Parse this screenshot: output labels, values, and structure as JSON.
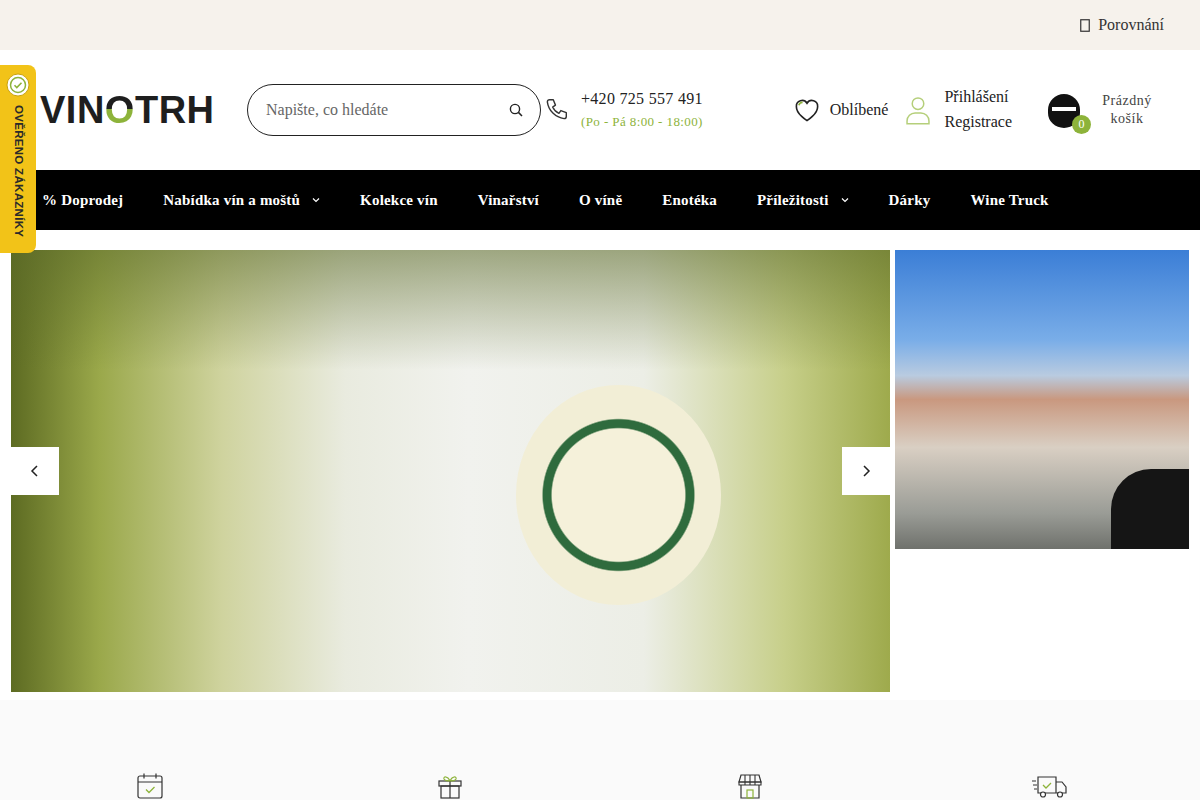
{
  "topbar": {
    "compare": "Porovnání"
  },
  "verified_badge": "OVĚŘENO ZÁKAZNÍKY",
  "logo": {
    "parts": [
      "VIN",
      "O",
      "TRH"
    ]
  },
  "search": {
    "placeholder": "Napište, co hledáte"
  },
  "contact": {
    "phone": "+420 725 557 491",
    "hours": "(Po - Pá 8:00 - 18:00)"
  },
  "favorites": "Oblíbené",
  "account": {
    "login": "Přihlášení",
    "register": "Registrace"
  },
  "cart": {
    "count": "0",
    "label": "Prázdný košík"
  },
  "menu": [
    {
      "label": "% Doprodej",
      "has_submenu": false
    },
    {
      "label": "Nabídka vín a moštů",
      "has_submenu": true
    },
    {
      "label": "Kolekce vín",
      "has_submenu": false
    },
    {
      "label": "Vinařství",
      "has_submenu": false
    },
    {
      "label": "O víně",
      "has_submenu": false
    },
    {
      "label": "Enotéka",
      "has_submenu": false
    },
    {
      "label": "Příležitosti",
      "has_submenu": true
    },
    {
      "label": "Dárky",
      "has_submenu": false
    },
    {
      "label": "Wine Truck",
      "has_submenu": false
    }
  ]
}
